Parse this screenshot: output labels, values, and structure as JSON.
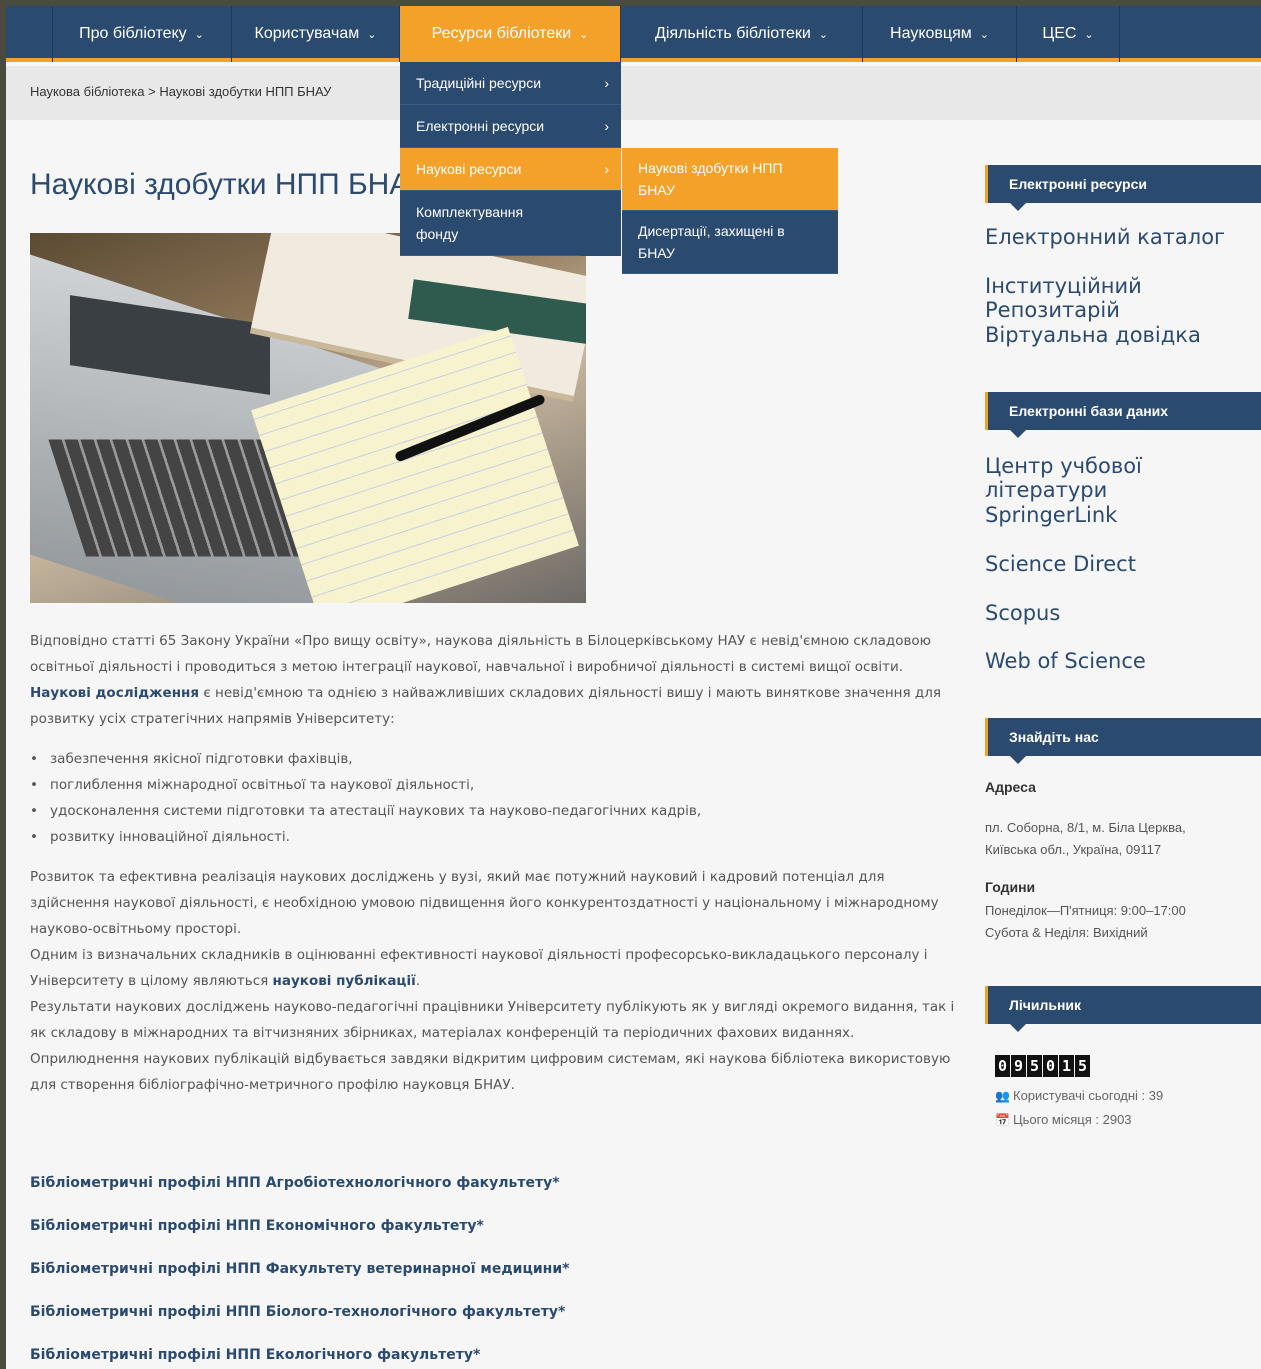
{
  "nav": {
    "items": [
      {
        "label": "Про бібліотеку"
      },
      {
        "label": "Користувачам"
      },
      {
        "label": "Ресурси бібліотеки"
      },
      {
        "label": "Діяльність бібліотеки"
      },
      {
        "label": "Науковцям"
      },
      {
        "label": "ЦЕС"
      }
    ],
    "chevron": "⌄"
  },
  "breadcrumb": {
    "home": "Наукова бібліотека",
    "sep": ">",
    "current": "Наукові здобутки НПП БНАУ"
  },
  "dropdown_l1": [
    {
      "label": "Традиційні ресурси"
    },
    {
      "label": "Електронні ресурси"
    },
    {
      "label": "Наукові ресурси"
    },
    {
      "label": "Комплектування фонду"
    }
  ],
  "dropdown_l2": [
    {
      "label": "Наукові здобутки НПП БНАУ"
    },
    {
      "label": "Дисертації, захищені в БНАУ"
    }
  ],
  "page": {
    "title": "Наукові здобутки НПП БНАУ"
  },
  "article": {
    "p1": "Відповідно статті 65 Закону України «Про вищу освіту», наукова діяльність в Білоцерківському НАУ є невід'ємною складовою освітньої діяльності і проводиться з метою інтеграції наукової, навчальної і виробничої діяльності в системі вищої освіти.",
    "p2_bold": "Наукові дослідження",
    "p2_rest": " є невід'ємною та однією з найважливіших складових діяльності вишу і мають виняткове значення для розвитку усіх стратегічних напрямів Університету:",
    "bullets": [
      "забезпечення якісної підготовки фахівців,",
      "поглиблення міжнародної освітньої та наукової діяльності,",
      "удосконалення системи підготовки та атестації наукових та науково-педагогічних кадрів,",
      "розвитку інноваційної діяльності."
    ],
    "p3": "Розвиток та ефективна реалізація наукових досліджень у вузі, який має потужний науковий і кадровий потенціал для здійснення наукової діяльності, є необхідною умовою підвищення його конкурентоздатності у національному і міжнародному науково-освітньому просторі.",
    "p4_start": "Одним із визначальних складників в оцінюванні ефективності наукової діяльності професорсько-викладацького персоналу і Університету в цілому являються ",
    "p4_bold": "наукові публікації",
    "p4_end": ".",
    "p5": "Результати наукових досліджень науково-педагогічні працівники Університету публікують як у вигляді окремого видання, так і як складову в міжнародних та вітчизняних збірниках, матеріалах конференцій та періодичних фахових виданнях.",
    "p6": "Оприлюднення наукових публікацій відбувається завдяки відкритим цифровим системам, які наукова бібліотека використовую для створення бібліографічно-метричного профілю науковця БНАУ."
  },
  "profile_links": [
    "Бібліометричні профілі НПП Агробіотехнологічного факультету*",
    "Бібліометричні профілі НПП Економічного факультету*",
    "Бібліометричні профілі НПП Факультету ветеринарної медицини*",
    "Бібліометричні профілі НПП Біолого-технологічного факультету*",
    "Бібліометричні профілі НПП Екологічного факультету*"
  ],
  "sidebar": {
    "e_resources_title": "Електронні ресурси",
    "e_resources": [
      "Електронний каталог",
      "Інституційний Репозитарій",
      "Віртуальна довідка"
    ],
    "databases_title": "Електронні бази даних",
    "databases": [
      "Центр учбової літератури",
      "SpringerLink",
      "Science Direct",
      "Scopus",
      "Web of Science"
    ],
    "find_title": "Знайдіть нас",
    "address_label": "Адреса",
    "address_line1": "пл. Соборна, 8/1, м. Біла Церква,",
    "address_line2": "Київська обл., Україна, 09117",
    "hours_label": "Години",
    "hours_line1": "Понеділок—П'ятниця: 9:00–17:00",
    "hours_line2": "Субота & Неділя: Вихідний",
    "counter_title": "Лічильник",
    "counter_digits": [
      "0",
      "9",
      "5",
      "0",
      "1",
      "5"
    ],
    "users_today": "Користувачі сьогодні : 39",
    "this_month": "Цього місяця : 2903"
  },
  "colors": {
    "navy": "#2b4a6f",
    "orange": "#f4a12a"
  }
}
